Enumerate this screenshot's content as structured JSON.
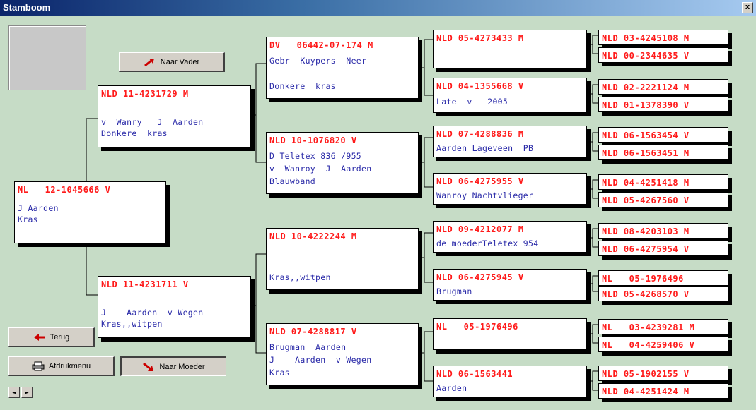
{
  "window": {
    "title": "Stamboom",
    "close_label": "x"
  },
  "buttons": {
    "vader": "Naar Vader",
    "terug": "Terug",
    "afdruk": "Afdrukmenu",
    "moeder": "Naar Moeder",
    "prev": "◄",
    "next": "►"
  },
  "boxes": {
    "b0": {
      "title": "NL   12-1045666 V",
      "lines": [
        "",
        "J Aarden",
        "Kras"
      ]
    },
    "b1": {
      "title": "NLD 11-4231729 M",
      "lines": [
        "",
        "v  Wanry   J  Aarden",
        "Donkere  kras"
      ]
    },
    "b2": {
      "title": "NLD 11-4231711 V",
      "lines": [
        "",
        "J    Aarden  v Wegen",
        "Kras,,witpen"
      ]
    },
    "b3": {
      "title": "DV   06442-07-174 M",
      "lines": [
        "Gebr  Kuypers  Neer",
        "",
        "Donkere  kras"
      ]
    },
    "b4": {
      "title": "NLD 10-1076820 V",
      "lines": [
        "D Teletex 836 /955",
        "v  Wanroy  J  Aarden",
        "Blauwband"
      ]
    },
    "b5": {
      "title": "NLD 10-4222244 M",
      "lines": [
        "",
        "",
        "Kras,,witpen"
      ]
    },
    "b6": {
      "title": "NLD 07-4288817 V",
      "lines": [
        "Brugman  Aarden",
        "J    Aarden  v Wegen",
        "Kras"
      ]
    },
    "c0": {
      "title": "NLD 05-4273433 M",
      "lines": [
        ""
      ]
    },
    "c1": {
      "title": "NLD 04-1355668 V",
      "lines": [
        "Late  v   2005"
      ]
    },
    "c2": {
      "title": "NLD 07-4288836 M",
      "lines": [
        "Aarden Lageveen  PB"
      ]
    },
    "c3": {
      "title": "NLD 06-4275955 V",
      "lines": [
        "Wanroy Nachtvlieger"
      ]
    },
    "c4": {
      "title": "NLD 09-4212077 M",
      "lines": [
        "de moederTeletex 954"
      ]
    },
    "c5": {
      "title": "NLD 06-4275945 V",
      "lines": [
        "Brugman"
      ]
    },
    "c6": {
      "title": "NL   05-1976496",
      "lines": [
        ""
      ]
    },
    "c7": {
      "title": "NLD 06-1563441",
      "lines": [
        "Aarden"
      ]
    },
    "d0": {
      "title": "NLD 03-4245108 M"
    },
    "d1": {
      "title": "NLD 00-2344635 V"
    },
    "d2": {
      "title": "NLD 02-2221124 M"
    },
    "d3": {
      "title": "NLD 01-1378390 V"
    },
    "d4": {
      "title": "NLD 06-1563454 V"
    },
    "d5": {
      "title": "NLD 06-1563451 M"
    },
    "d6": {
      "title": "NLD 04-4251418 M"
    },
    "d7": {
      "title": "NLD 05-4267560 V"
    },
    "d8": {
      "title": "NLD 08-4203103 M"
    },
    "d9": {
      "title": "NLD 06-4275954 V"
    },
    "d10": {
      "title": "NL   05-1976496"
    },
    "d11": {
      "title": "NLD 05-4268570 V"
    },
    "d12": {
      "title": "NL   03-4239281 M"
    },
    "d13": {
      "title": "NL   04-4259406 V"
    },
    "d14": {
      "title": "NLD 05-1902155 V"
    },
    "d15": {
      "title": "NLD 04-4251424 M"
    }
  }
}
